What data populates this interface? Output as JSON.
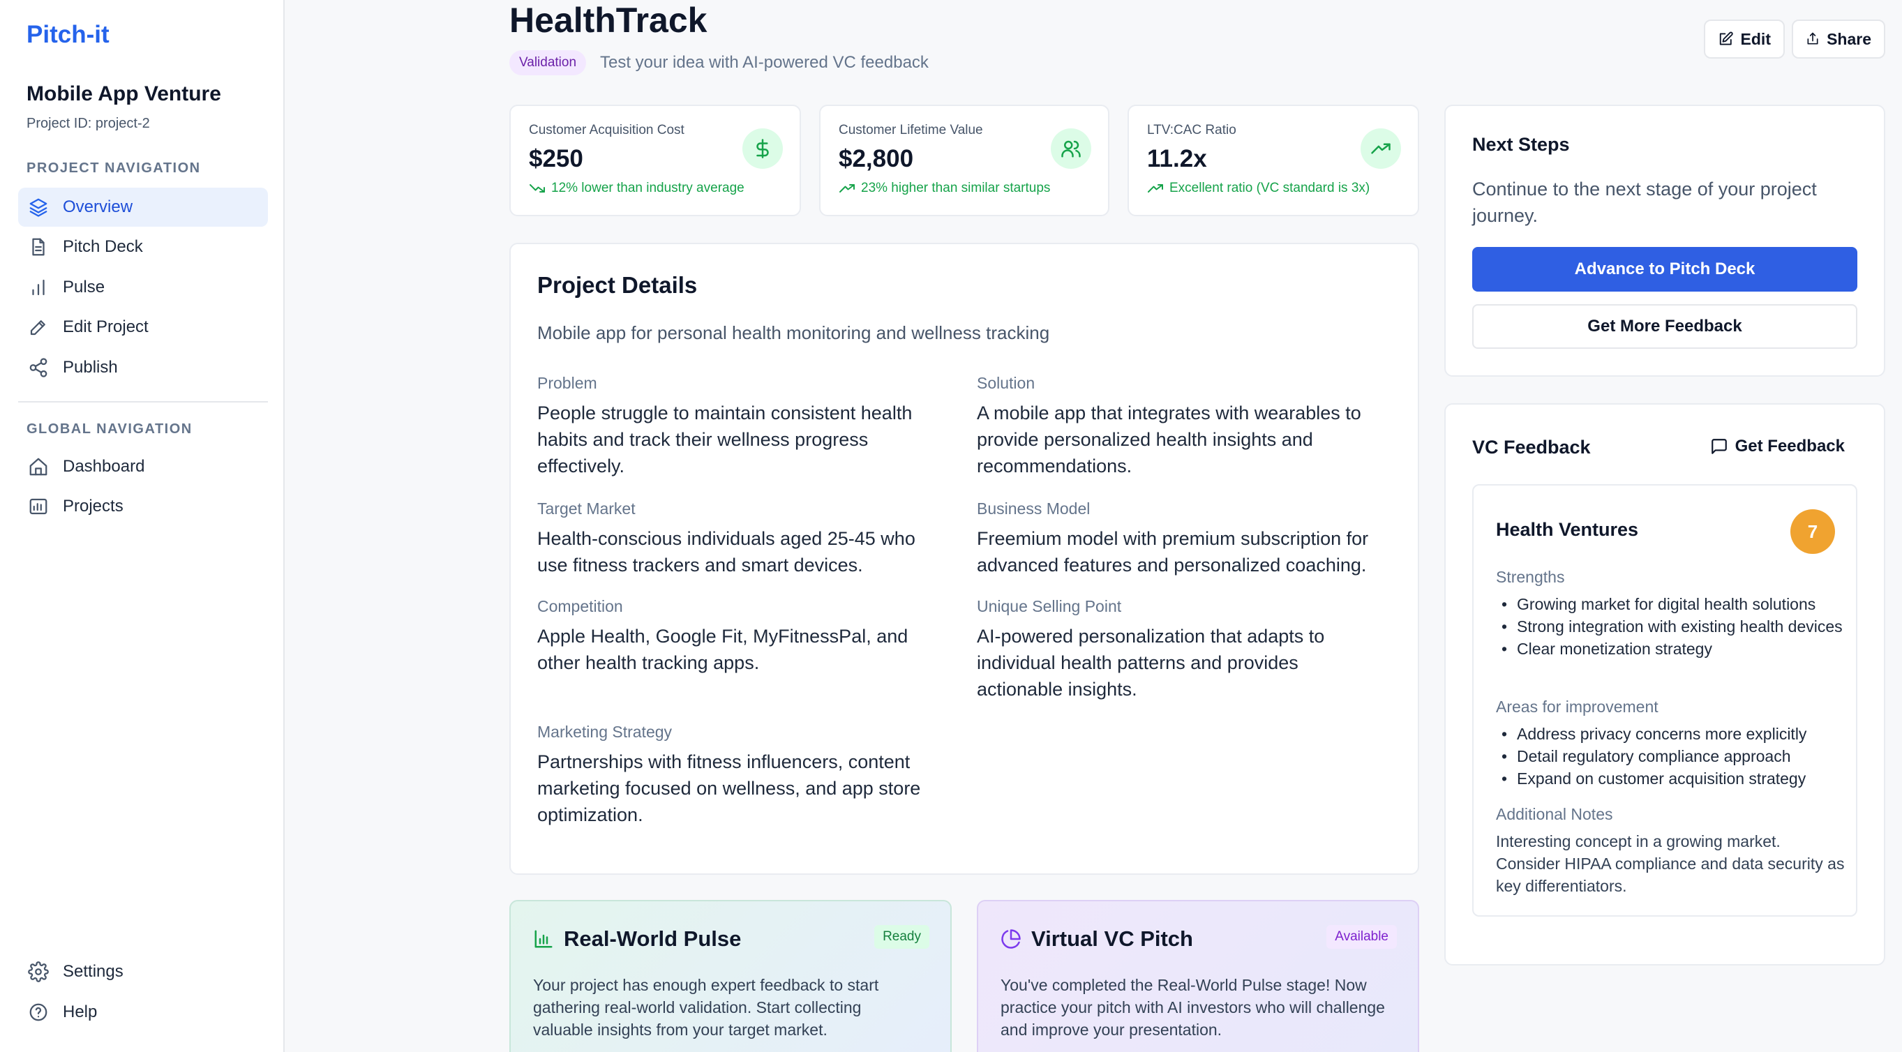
{
  "sidebar": {
    "brand": "Pitch-it",
    "project_name": "Mobile App Venture",
    "project_id": "Project ID: project-2",
    "project_nav_title": "PROJECT NAVIGATION",
    "project_nav": [
      {
        "label": "Overview",
        "icon": "layers-icon"
      },
      {
        "label": "Pitch Deck",
        "icon": "document-icon"
      },
      {
        "label": "Pulse",
        "icon": "bar-chart-icon"
      },
      {
        "label": "Edit Project",
        "icon": "pen-icon"
      },
      {
        "label": "Publish",
        "icon": "share-nodes-icon"
      }
    ],
    "global_nav_title": "GLOBAL NAVIGATION",
    "global_nav": [
      {
        "label": "Dashboard",
        "icon": "home-icon"
      },
      {
        "label": "Projects",
        "icon": "image-icon"
      }
    ],
    "footer_nav": [
      {
        "label": "Settings",
        "icon": "gear-icon"
      },
      {
        "label": "Help",
        "icon": "help-circle-icon"
      }
    ]
  },
  "header": {
    "title": "HealthTrack",
    "stage_badge": "Validation",
    "subtitle": "Test your idea with AI-powered VC feedback",
    "edit_label": "Edit",
    "share_label": "Share"
  },
  "metrics": [
    {
      "label": "Customer Acquisition Cost",
      "value": "$250",
      "note": "12% lower than industry average",
      "trend": "down",
      "icon": "dollar-icon"
    },
    {
      "label": "Customer Lifetime Value",
      "value": "$2,800",
      "note": "23% higher than similar startups",
      "trend": "up",
      "icon": "users-icon"
    },
    {
      "label": "LTV:CAC Ratio",
      "value": "11.2x",
      "note": "Excellent ratio (VC standard is 3x)",
      "trend": "up",
      "icon": "trending-up-icon"
    }
  ],
  "project_details": {
    "title": "Project Details",
    "description": "Mobile app for personal health monitoring and wellness tracking",
    "fields": [
      {
        "label": "Problem",
        "value": "People struggle to maintain consistent health habits and track their wellness progress effectively."
      },
      {
        "label": "Solution",
        "value": "A mobile app that integrates with wearables to provide personalized health insights and recommendations."
      },
      {
        "label": "Target Market",
        "value": "Health-conscious individuals aged 25-45 who use fitness trackers and smart devices."
      },
      {
        "label": "Business Model",
        "value": "Freemium model with premium subscription for advanced features and personalized coaching."
      },
      {
        "label": "Competition",
        "value": "Apple Health, Google Fit, MyFitnessPal, and other health tracking apps."
      },
      {
        "label": "Unique Selling Point",
        "value": "AI-powered personalization that adapts to individual health patterns and provides actionable insights."
      },
      {
        "label": "Marketing Strategy",
        "value": "Partnerships with fitness influencers, content marketing focused on wellness, and app store optimization."
      }
    ]
  },
  "stage_cards": [
    {
      "title": "Real-World Pulse",
      "badge": "Ready",
      "description": "Your project has enough expert feedback to start gathering real-world validation. Start collecting valuable insights from your target market."
    },
    {
      "title": "Virtual VC Pitch",
      "badge": "Available",
      "description": "You've completed the Real-World Pulse stage! Now practice your pitch with AI investors who will challenge and improve your presentation."
    }
  ],
  "next_steps": {
    "title": "Next Steps",
    "description": "Continue to the next stage of your project journey.",
    "primary_label": "Advance to Pitch Deck",
    "secondary_label": "Get More Feedback"
  },
  "vc_feedback": {
    "title": "VC Feedback",
    "get_label": "Get Feedback",
    "investor": "Health Ventures",
    "score": "7",
    "strengths_title": "Strengths",
    "strengths": [
      "Growing market for digital health solutions",
      "Strong integration with existing health devices",
      "Clear monetization strategy"
    ],
    "improvements_title": "Areas for improvement",
    "improvements": [
      "Address privacy concerns more explicitly",
      "Detail regulatory compliance approach",
      "Expand on customer acquisition strategy"
    ],
    "notes_title": "Additional Notes",
    "notes": "Interesting concept in a growing market. Consider HIPAA compliance and data security as key differentiators."
  },
  "colors": {
    "accent": "#2563eb",
    "primary_button": "#2f5fe3",
    "positive": "#16a34a",
    "score": "#f0a330",
    "stage_badge_bg": "#f3e8ff"
  }
}
